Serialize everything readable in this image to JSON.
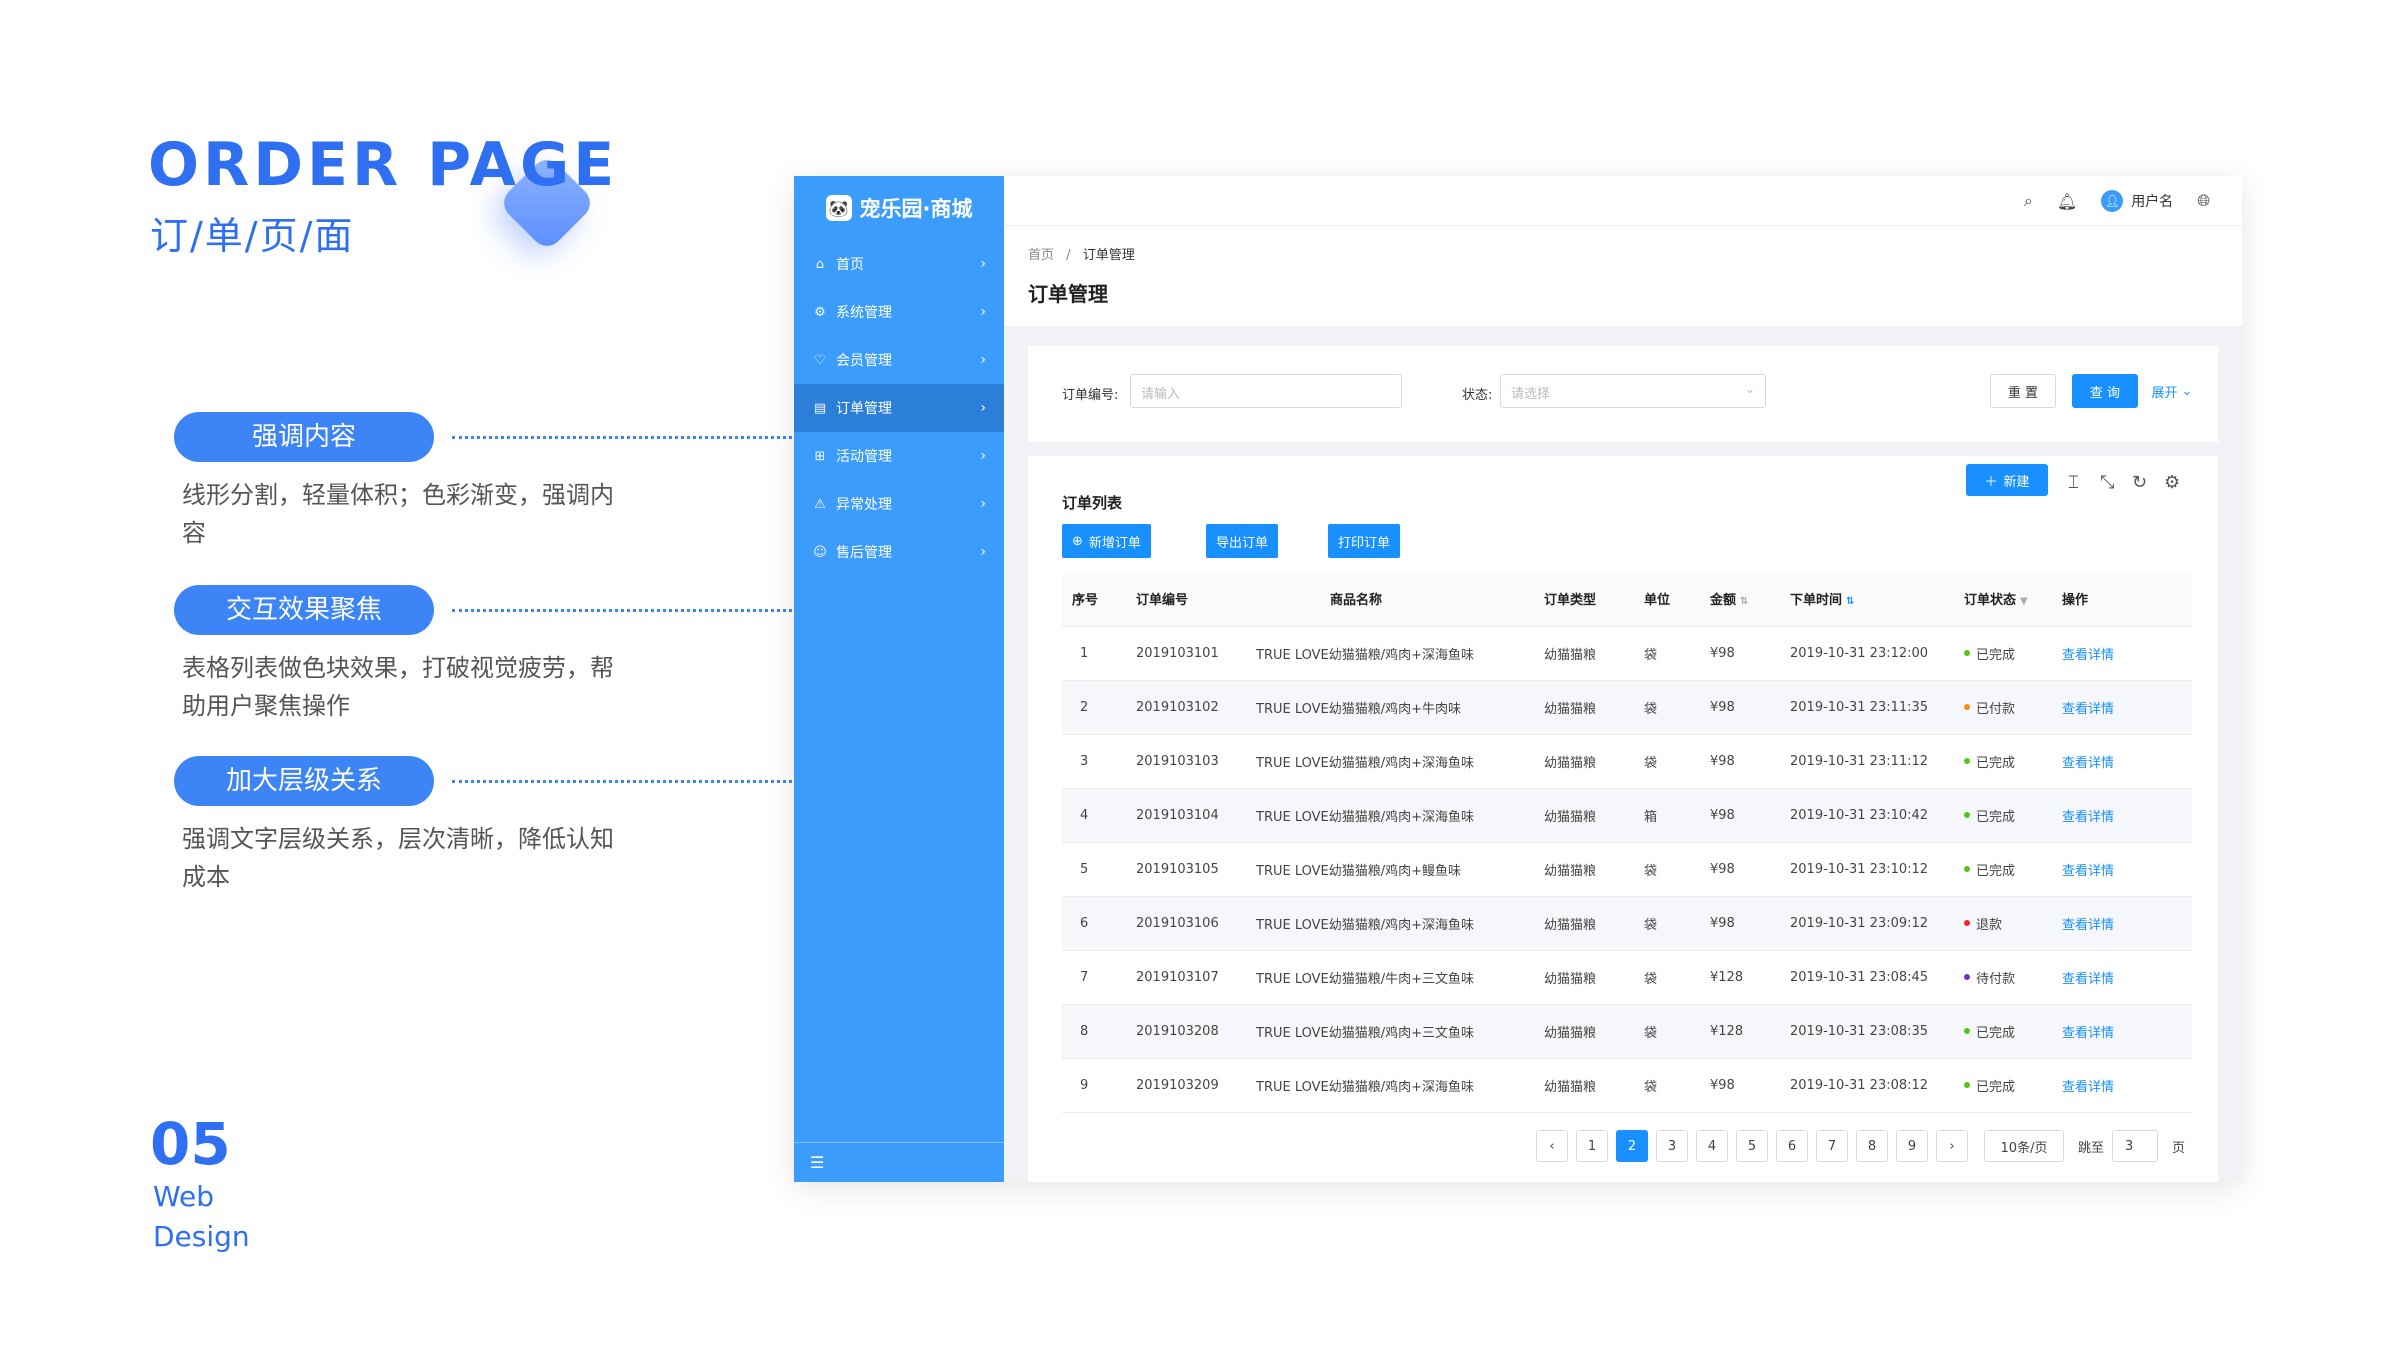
{
  "hero": {
    "title": "ORDER PAGE",
    "subtitle": "订/单/页/面"
  },
  "features": [
    {
      "label": "强调内容",
      "desc": "线形分割，轻量体积；色彩渐变，强调内容"
    },
    {
      "label": "交互效果聚焦",
      "desc": "表格列表做色块效果，打破视觉疲劳，帮助用户聚焦操作"
    },
    {
      "label": "加大层级关系",
      "desc": "强调文字层级关系，层次清晰，降低认知成本"
    }
  ],
  "footer": {
    "number": "05",
    "line1": "Web",
    "line2": "Design"
  },
  "app": {
    "logo": "宠乐园·商城",
    "menu": [
      {
        "label": "首页",
        "icon": "home-icon"
      },
      {
        "label": "系统管理",
        "icon": "settings-icon"
      },
      {
        "label": "会员管理",
        "icon": "member-icon"
      },
      {
        "label": "订单管理",
        "icon": "order-icon",
        "active": true
      },
      {
        "label": "活动管理",
        "icon": "gift-icon"
      },
      {
        "label": "异常处理",
        "icon": "warning-icon"
      },
      {
        "label": "售后管理",
        "icon": "service-icon"
      }
    ],
    "header": {
      "username": "用户名"
    },
    "breadcrumb": {
      "home": "首页",
      "sep": "/",
      "current": "订单管理"
    },
    "page_title": "订单管理",
    "filter": {
      "order_no_label": "订单编号:",
      "order_no_placeholder": "请输入",
      "status_label": "状态:",
      "status_placeholder": "请选择",
      "reset": "重 置",
      "query": "查 询",
      "expand": "展开"
    },
    "list": {
      "title": "订单列表",
      "new_button": "新建",
      "actions": [
        "新增订单",
        "导出订单",
        "打印订单"
      ],
      "columns": [
        "序号",
        "订单编号",
        "商品名称",
        "订单类型",
        "单位",
        "金额",
        "下单时间",
        "订单状态",
        "操作"
      ],
      "rows": [
        {
          "no": "1",
          "id": "2019103101",
          "name": "TRUE LOVE幼猫猫粮/鸡肉+深海鱼味",
          "type": "幼猫猫粮",
          "unit": "袋",
          "amount": "¥98",
          "time": "2019-10-31  23:12:00",
          "status": "已完成",
          "color": "#52c41a",
          "op": "查看详情"
        },
        {
          "no": "2",
          "id": "2019103102",
          "name": "TRUE LOVE幼猫猫粮/鸡肉+牛肉味",
          "type": "幼猫猫粮",
          "unit": "袋",
          "amount": "¥98",
          "time": "2019-10-31  23:11:35",
          "status": "已付款",
          "color": "#fa8c16",
          "op": "查看详情"
        },
        {
          "no": "3",
          "id": "2019103103",
          "name": "TRUE LOVE幼猫猫粮/鸡肉+深海鱼味",
          "type": "幼猫猫粮",
          "unit": "袋",
          "amount": "¥98",
          "time": "2019-10-31  23:11:12",
          "status": "已完成",
          "color": "#52c41a",
          "op": "查看详情"
        },
        {
          "no": "4",
          "id": "2019103104",
          "name": "TRUE LOVE幼猫猫粮/鸡肉+深海鱼味",
          "type": "幼猫猫粮",
          "unit": "箱",
          "amount": "¥98",
          "time": "2019-10-31  23:10:42",
          "status": "已完成",
          "color": "#52c41a",
          "op": "查看详情"
        },
        {
          "no": "5",
          "id": "2019103105",
          "name": "TRUE LOVE幼猫猫粮/鸡肉+鳗鱼味",
          "type": "幼猫猫粮",
          "unit": "袋",
          "amount": "¥98",
          "time": "2019-10-31  23:10:12",
          "status": "已完成",
          "color": "#52c41a",
          "op": "查看详情"
        },
        {
          "no": "6",
          "id": "2019103106",
          "name": "TRUE LOVE幼猫猫粮/鸡肉+深海鱼味",
          "type": "幼猫猫粮",
          "unit": "袋",
          "amount": "¥98",
          "time": "2019-10-31  23:09:12",
          "status": "退款",
          "color": "#f5222d",
          "op": "查看详情"
        },
        {
          "no": "7",
          "id": "2019103107",
          "name": "TRUE LOVE幼猫猫粮/牛肉+三文鱼味",
          "type": "幼猫猫粮",
          "unit": "袋",
          "amount": "¥128",
          "time": "2019-10-31  23:08:45",
          "status": "待付款",
          "color": "#722ed1",
          "op": "查看详情"
        },
        {
          "no": "8",
          "id": "2019103208",
          "name": "TRUE LOVE幼猫猫粮/鸡肉+三文鱼味",
          "type": "幼猫猫粮",
          "unit": "袋",
          "amount": "¥128",
          "time": "2019-10-31  23:08:35",
          "status": "已完成",
          "color": "#52c41a",
          "op": "查看详情"
        },
        {
          "no": "9",
          "id": "2019103209",
          "name": "TRUE LOVE幼猫猫粮/鸡肉+深海鱼味",
          "type": "幼猫猫粮",
          "unit": "袋",
          "amount": "¥98",
          "time": "2019-10-31  23:08:12",
          "status": "已完成",
          "color": "#52c41a",
          "op": "查看详情"
        }
      ]
    },
    "pagination": {
      "pages": [
        "1",
        "2",
        "3",
        "4",
        "5",
        "6",
        "7",
        "8",
        "9"
      ],
      "current": "2",
      "size": "10条/页",
      "jump_label": "跳至",
      "jump_value": "3",
      "page_suffix": "页"
    }
  }
}
